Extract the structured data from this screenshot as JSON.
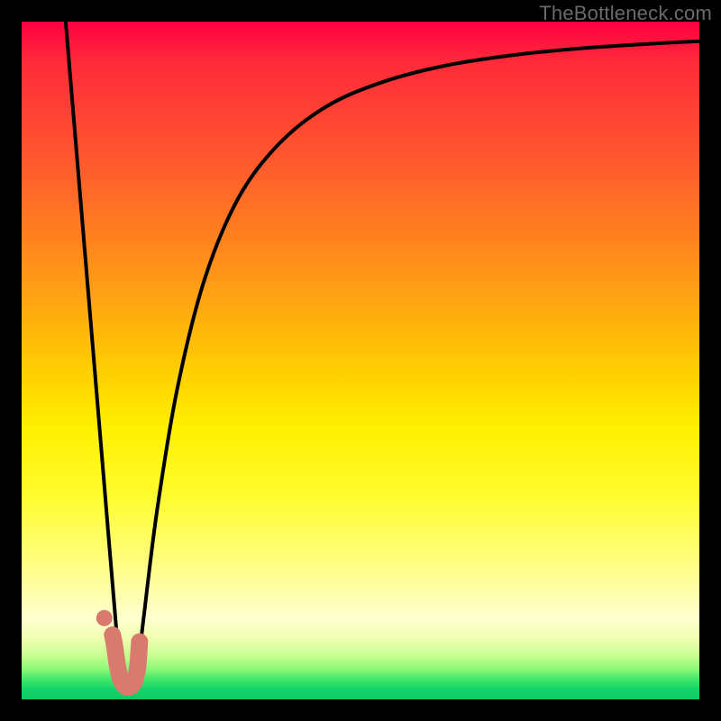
{
  "watermark": "TheBottleneck.com",
  "colors": {
    "background": "#000000",
    "curve": "#000000",
    "marker": "#d97a6e"
  },
  "chart_data": {
    "type": "line",
    "title": "",
    "xlabel": "",
    "ylabel": "",
    "xlim": [
      0,
      100
    ],
    "ylim": [
      0,
      100
    ],
    "grid": false,
    "series": [
      {
        "name": "left-branch",
        "x": [
          6.5,
          8,
          10,
          12,
          14,
          14.8
        ],
        "y": [
          100,
          82,
          58,
          34,
          10,
          2
        ]
      },
      {
        "name": "right-branch",
        "x": [
          16.8,
          18,
          20,
          23,
          27,
          32,
          38,
          45,
          53,
          62,
          72,
          83,
          94,
          100
        ],
        "y": [
          2,
          12,
          28,
          46,
          62,
          74,
          82,
          87.5,
          91,
          93.4,
          95,
          96.1,
          96.8,
          97.1
        ]
      }
    ],
    "marker": {
      "name": "J-marker",
      "points": [
        {
          "x": 13.4,
          "y": 9.5
        },
        {
          "x": 13.7,
          "y": 8.0
        },
        {
          "x": 14.1,
          "y": 5.2
        },
        {
          "x": 14.5,
          "y": 3.3
        },
        {
          "x": 15.0,
          "y": 2.2
        },
        {
          "x": 15.6,
          "y": 1.8
        },
        {
          "x": 16.2,
          "y": 2.0
        },
        {
          "x": 16.7,
          "y": 2.8
        },
        {
          "x": 17.0,
          "y": 4.0
        },
        {
          "x": 17.2,
          "y": 5.5
        },
        {
          "x": 17.3,
          "y": 7.0
        },
        {
          "x": 17.4,
          "y": 8.5
        }
      ],
      "dot": {
        "x": 12.2,
        "y": 12.0
      }
    }
  }
}
